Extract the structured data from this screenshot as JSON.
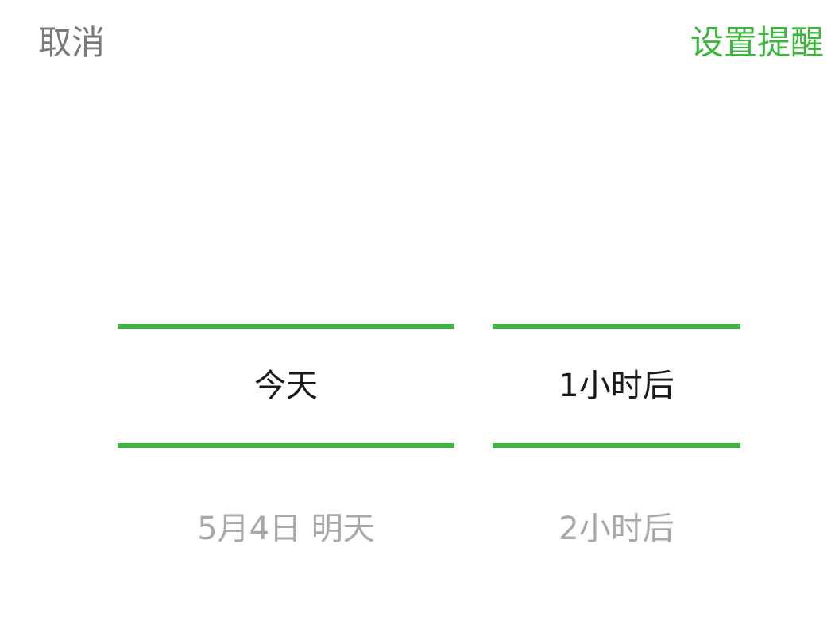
{
  "header": {
    "cancel_label": "取消",
    "confirm_label": "设置提醒"
  },
  "picker": {
    "day_column": {
      "selected": "今天",
      "next": "5月4日 明天"
    },
    "time_column": {
      "selected": "1小时后",
      "next": "2小时后"
    }
  },
  "colors": {
    "accent": "#3db63d",
    "cancel_text": "#7a7a7a",
    "selected_text": "#1a1a1a",
    "unselected_text": "#a8a8a8",
    "background": "#ffffff"
  }
}
